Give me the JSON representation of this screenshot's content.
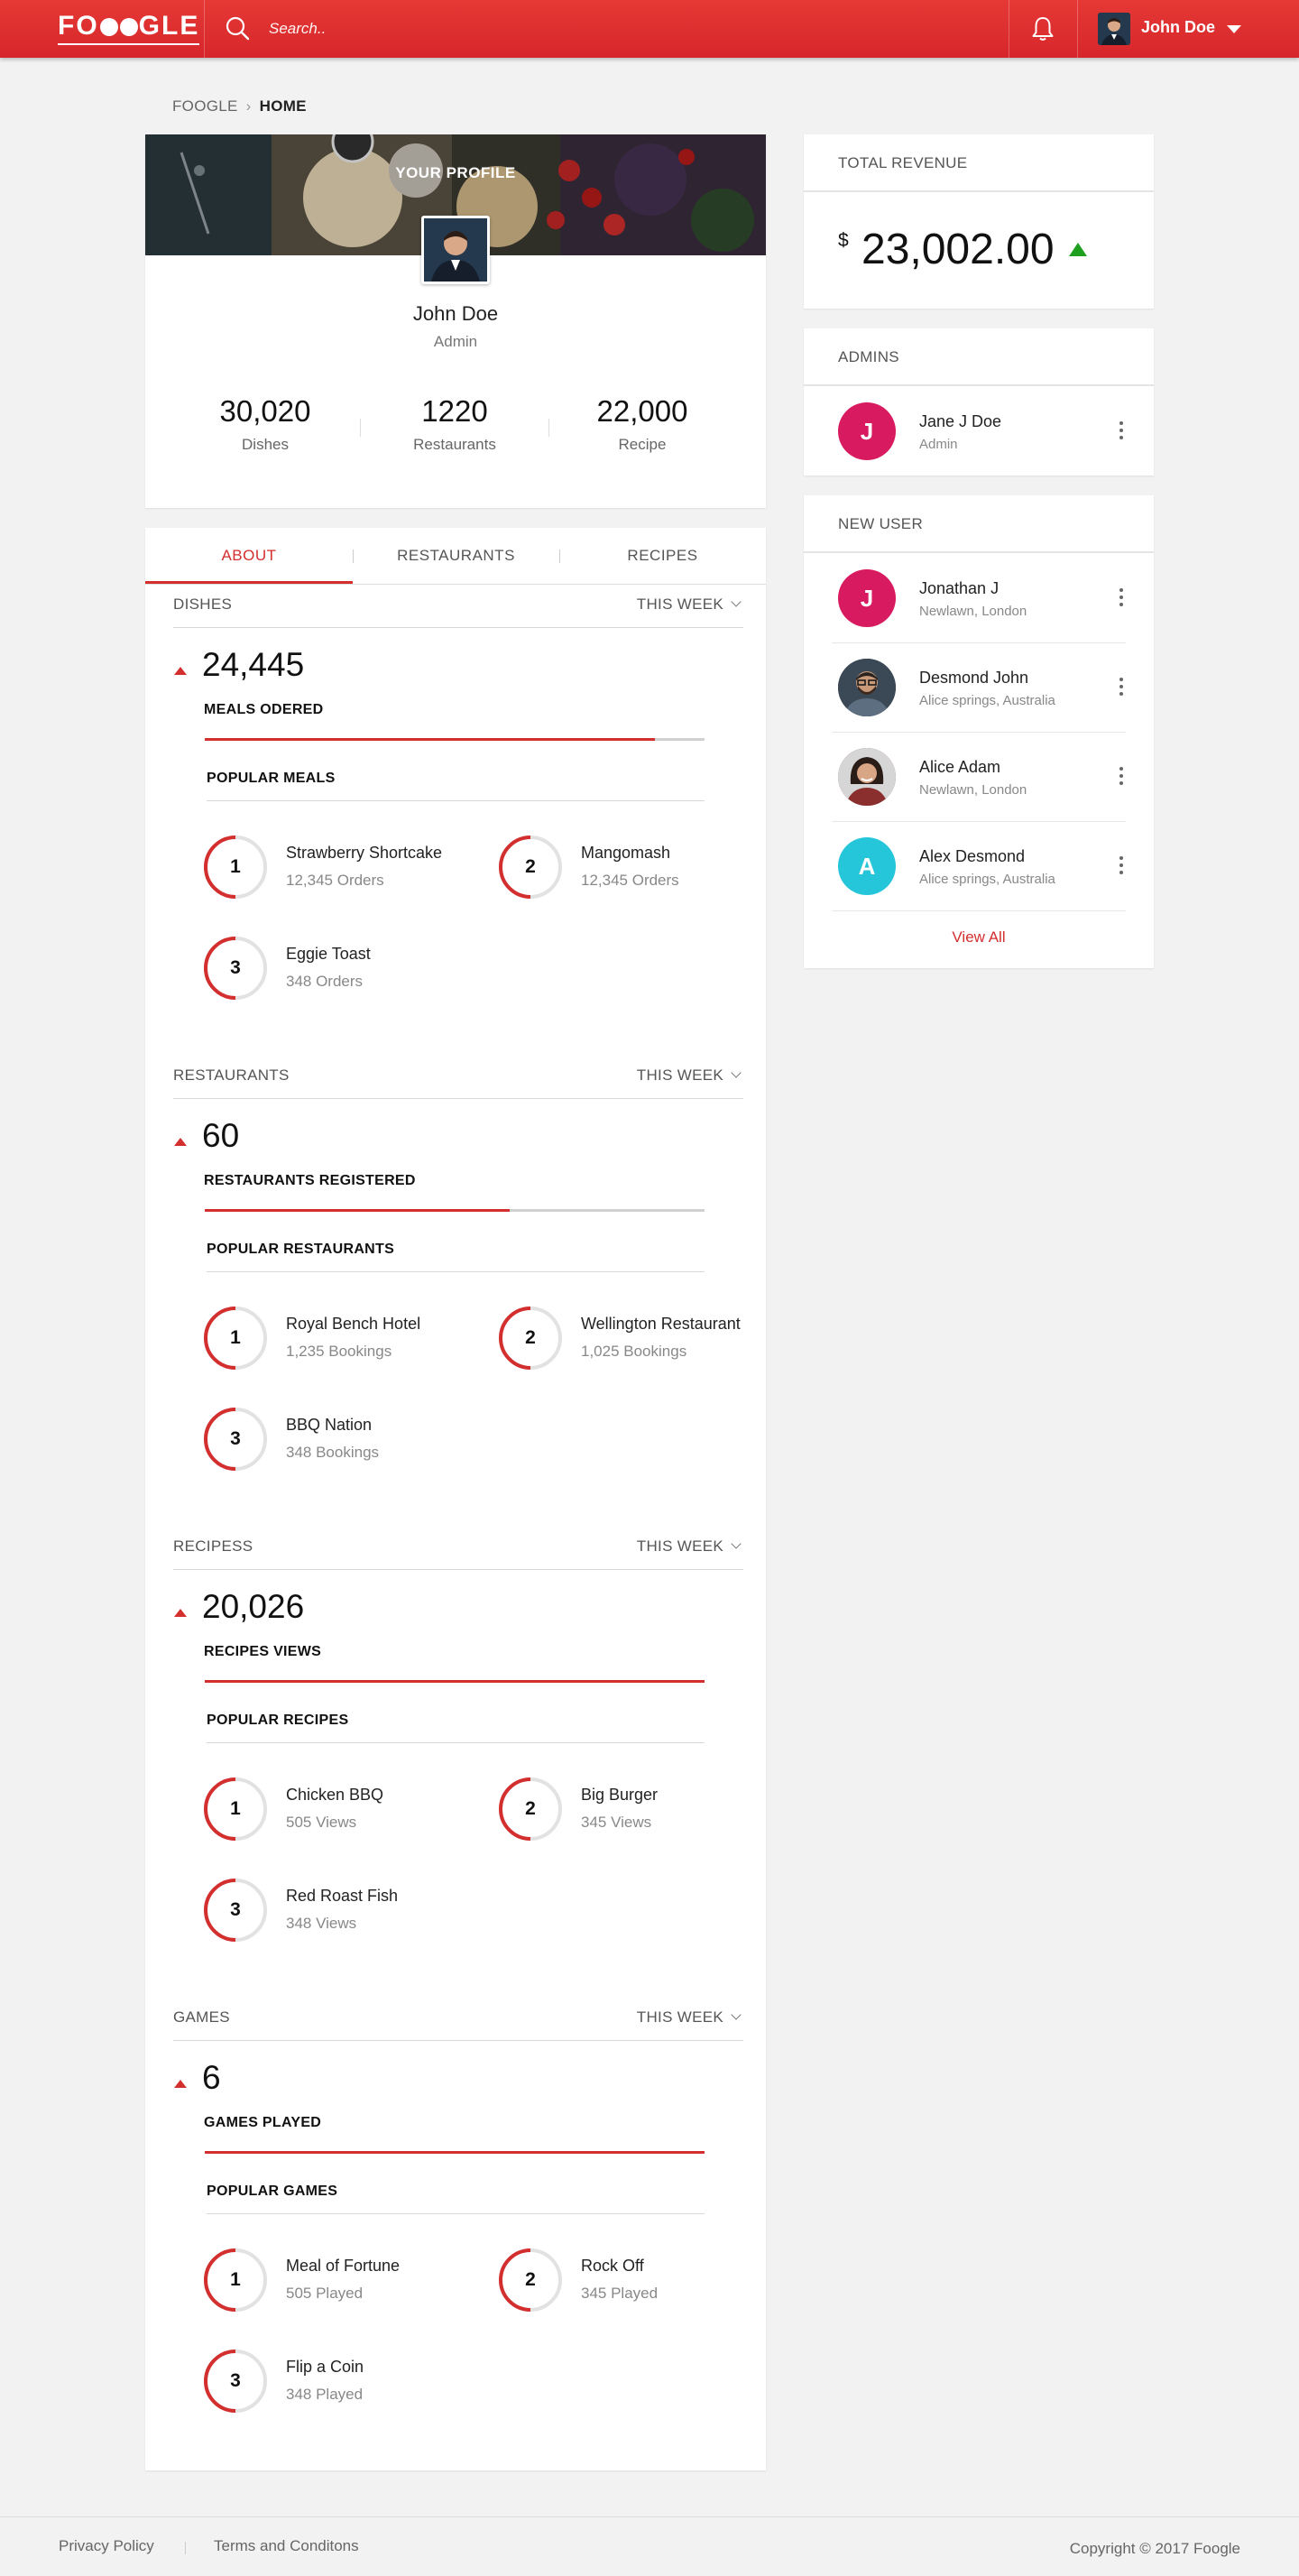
{
  "header": {
    "logo": "FOOGLE",
    "search_placeholder": "Search..",
    "user_name": "John Doe"
  },
  "breadcrumb": {
    "root": "FOOGLE",
    "current": "HOME"
  },
  "profile": {
    "cover_title": "YOUR PROFILE",
    "name": "John Doe",
    "role": "Admin",
    "stats": [
      {
        "value": "30,020",
        "label": "Dishes"
      },
      {
        "value": "1220",
        "label": "Restaurants"
      },
      {
        "value": "22,000",
        "label": "Recipe"
      }
    ]
  },
  "tabs": [
    "ABOUT",
    "RESTAURANTS",
    "RECIPES"
  ],
  "sections": [
    {
      "title": "DISHES",
      "range": "THIS WEEK",
      "value": "24,445",
      "metric": "MEALS ODERED",
      "progress": 0.9,
      "popular_title": "POPULAR MEALS",
      "items": [
        {
          "rank": "1",
          "name": "Strawberry Shortcake",
          "sub": "12,345 Orders"
        },
        {
          "rank": "2",
          "name": "Mangomash",
          "sub": "12,345 Orders"
        },
        {
          "rank": "3",
          "name": "Eggie Toast",
          "sub": "348 Orders"
        }
      ]
    },
    {
      "title": "RESTAURANTS",
      "range": "THIS WEEK",
      "value": "60",
      "metric": "RESTAURANTS REGISTERED",
      "progress": 0.61,
      "popular_title": "POPULAR RESTAURANTS",
      "items": [
        {
          "rank": "1",
          "name": "Royal Bench Hotel",
          "sub": "1,235 Bookings"
        },
        {
          "rank": "2",
          "name": "Wellington Restaurant",
          "sub": "1,025 Bookings"
        },
        {
          "rank": "3",
          "name": "BBQ Nation",
          "sub": "348 Bookings"
        }
      ]
    },
    {
      "title": "RECIPESS",
      "range": "THIS WEEK",
      "value": "20,026",
      "metric": "RECIPES VIEWS",
      "progress": 1.0,
      "popular_title": "POPULAR RECIPES",
      "items": [
        {
          "rank": "1",
          "name": "Chicken BBQ",
          "sub": "505 Views"
        },
        {
          "rank": "2",
          "name": "Big Burger",
          "sub": "345 Views"
        },
        {
          "rank": "3",
          "name": "Red Roast Fish",
          "sub": "348 Views"
        }
      ]
    },
    {
      "title": "GAMES",
      "range": "THIS WEEK",
      "value": "6",
      "metric": "GAMES PLAYED",
      "progress": 1.0,
      "popular_title": "POPULAR GAMES",
      "items": [
        {
          "rank": "1",
          "name": "Meal of Fortune",
          "sub": "505 Played"
        },
        {
          "rank": "2",
          "name": "Rock Off",
          "sub": "345 Played"
        },
        {
          "rank": "3",
          "name": "Flip a Coin",
          "sub": "348 Played"
        }
      ]
    }
  ],
  "revenue": {
    "title": "TOTAL REVENUE",
    "currency": "$",
    "value": "23,002.00"
  },
  "admins": {
    "title": "ADMINS",
    "items": [
      {
        "initial": "J",
        "name": "Jane J Doe",
        "sub": "Admin",
        "color": "#d81b60"
      }
    ]
  },
  "new_users": {
    "title": "NEW USER",
    "items": [
      {
        "initial": "J",
        "name": "Jonathan J",
        "sub": "Newlawn, London",
        "color": "#d81b60"
      },
      {
        "initial": "",
        "name": "Desmond John",
        "sub": "Alice springs, Australia",
        "color": "#2f3e4c"
      },
      {
        "initial": "",
        "name": "Alice Adam",
        "sub": "Newlawn, London",
        "color": "#8b3a3a"
      },
      {
        "initial": "A",
        "name": "Alex Desmond",
        "sub": "Alice springs, Australia",
        "color": "#26c6da"
      }
    ],
    "view_all": "View All"
  },
  "footer": {
    "privacy": "Privacy Policy",
    "terms": "Terms and Conditons",
    "copyright": "Copyright © 2017 Foogle"
  },
  "colors": {
    "accent": "#d32f2f",
    "up": "#1ea01e"
  }
}
